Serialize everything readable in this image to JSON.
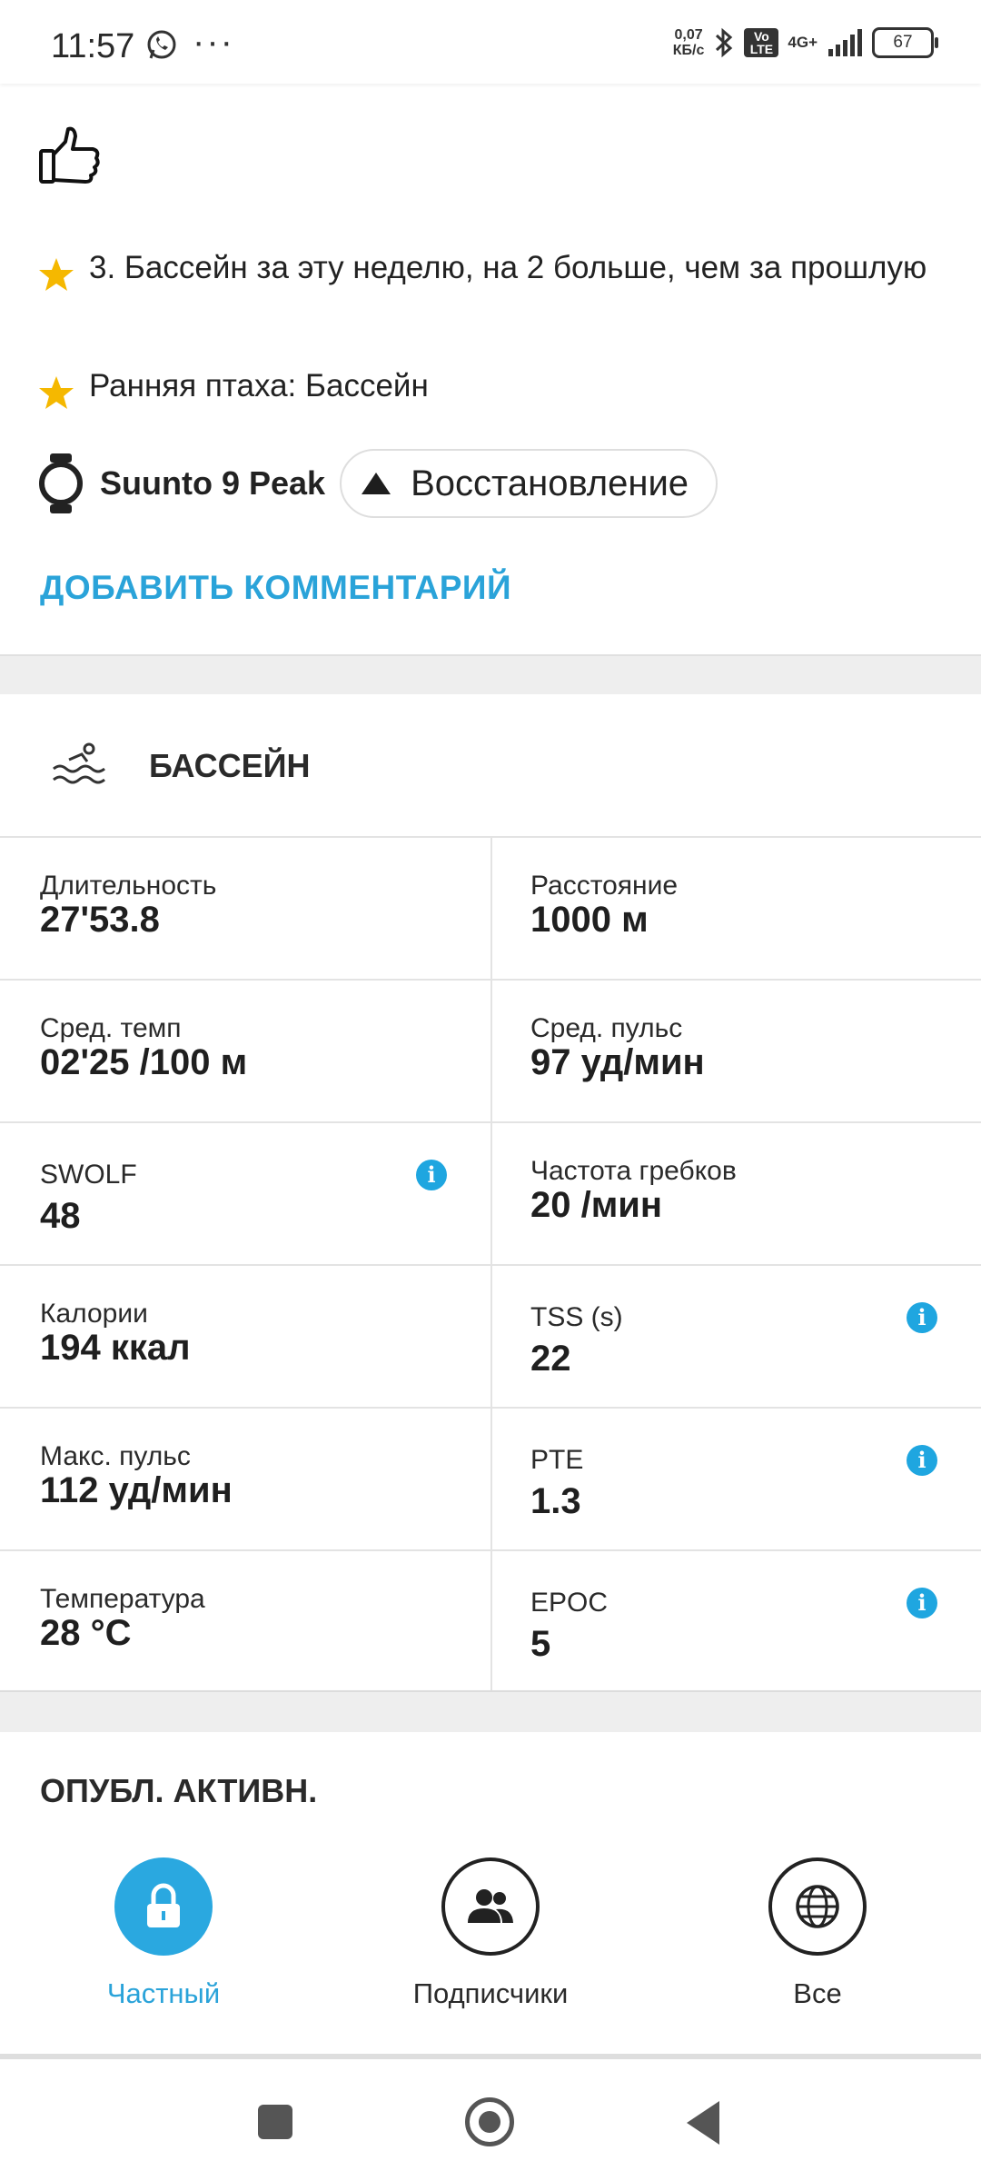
{
  "status_bar": {
    "time": "11:57",
    "speed_value": "0,07",
    "speed_unit": "КБ/с",
    "volte": "Vo LTE",
    "network": "4G+",
    "battery": "67"
  },
  "achievements": [
    {
      "icon": "star-icon",
      "text": "3. Бассейн за эту неделю, на 2 больше, чем за прошлую"
    },
    {
      "icon": "star-icon",
      "text": "Ранняя птаха: Бассейн"
    }
  ],
  "device": {
    "name": "Suunto 9 Peak",
    "tag": "Восстановление"
  },
  "add_comment": "ДОБАВИТЬ КОММЕНТАРИЙ",
  "activity": {
    "title": "БАССЕЙН",
    "stats": [
      {
        "label": "Длительность",
        "value": "27'53.8"
      },
      {
        "label": "Расстояние",
        "value": "1000 м"
      },
      {
        "label": "Сред. темп",
        "value": "02'25 /100 м"
      },
      {
        "label": "Сред. пульс",
        "value": "97 уд/мин"
      },
      {
        "label": "SWOLF",
        "value": "48"
      },
      {
        "label": "Частота гребков",
        "value": "20 /мин"
      },
      {
        "label": "Калории",
        "value": "194 ккал"
      },
      {
        "label": "TSS (s)",
        "value": "22"
      },
      {
        "label": "Макс. пульс",
        "value": "112 уд/мин"
      },
      {
        "label": "PTE",
        "value": "1.3"
      },
      {
        "label": "Температура",
        "value": "28 °C"
      },
      {
        "label": "EPOC",
        "value": "5"
      }
    ]
  },
  "publish": {
    "title": "ОПУБЛ. АКТИВН.",
    "options": [
      {
        "label": "Частный",
        "icon": "lock-icon",
        "selected": true
      },
      {
        "label": "Подписчики",
        "icon": "followers-icon",
        "selected": false
      },
      {
        "label": "Все",
        "icon": "globe-icon",
        "selected": false
      }
    ]
  },
  "colors": {
    "accent": "#2aa3d9",
    "info": "#1fa6e0",
    "star": "#f5b800"
  }
}
